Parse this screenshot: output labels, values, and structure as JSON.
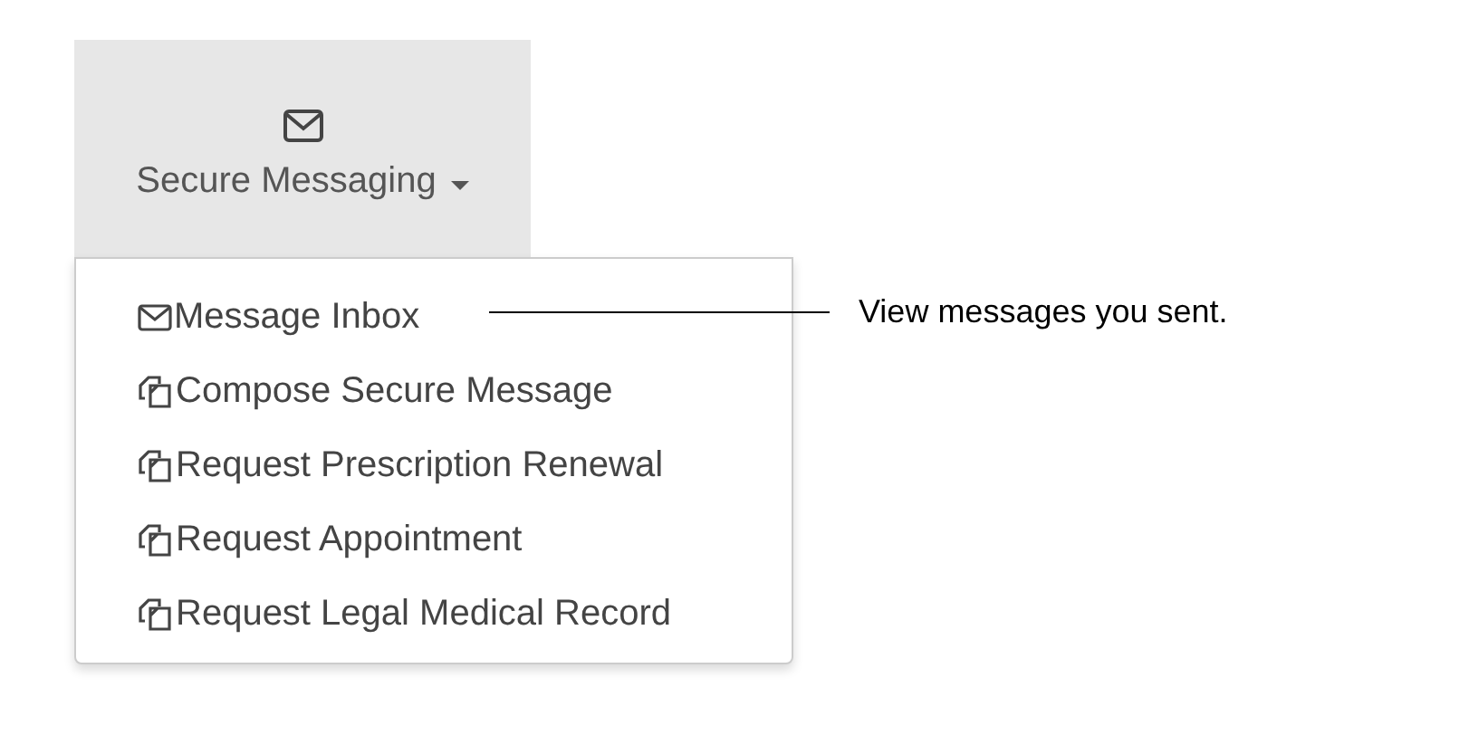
{
  "nav_button": {
    "label": "Secure Messaging",
    "expanded": true
  },
  "menu_items": [
    {
      "kind": "inbox",
      "label": "Message Inbox"
    },
    {
      "kind": "form",
      "label": "Compose Secure Message"
    },
    {
      "kind": "form",
      "label": "Request Prescription Renewal"
    },
    {
      "kind": "form",
      "label": "Request Appointment"
    },
    {
      "kind": "form",
      "label": "Request Legal Medical Record"
    }
  ],
  "callout": {
    "text": "View messages you sent."
  }
}
